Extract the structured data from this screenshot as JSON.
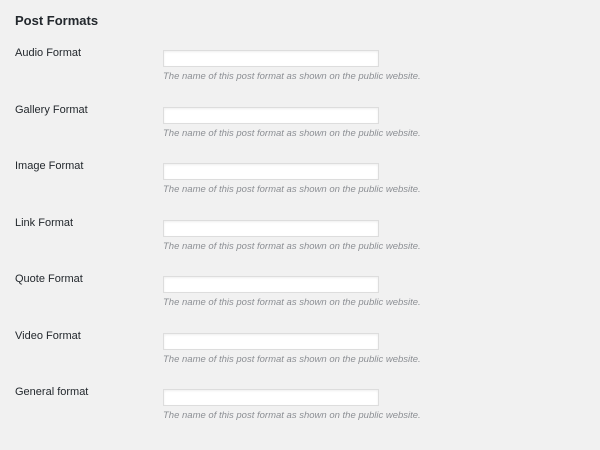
{
  "section": {
    "title": "Post Formats"
  },
  "formats": [
    {
      "label": "Audio Format",
      "value": "",
      "description": "The name of this post format as shown on the public website."
    },
    {
      "label": "Gallery Format",
      "value": "",
      "description": "The name of this post format as shown on the public website."
    },
    {
      "label": "Image Format",
      "value": "",
      "description": "The name of this post format as shown on the public website."
    },
    {
      "label": "Link Format",
      "value": "",
      "description": "The name of this post format as shown on the public website."
    },
    {
      "label": "Quote Format",
      "value": "",
      "description": "The name of this post format as shown on the public website."
    },
    {
      "label": "Video Format",
      "value": "",
      "description": "The name of this post format as shown on the public website."
    },
    {
      "label": "General format",
      "value": "",
      "description": "The name of this post format as shown on the public website."
    }
  ],
  "colors": {
    "background": "#f1f1f1",
    "text": "#23282d",
    "description": "#8c8f94",
    "input_border": "#dddddd",
    "input_background": "#ffffff"
  }
}
